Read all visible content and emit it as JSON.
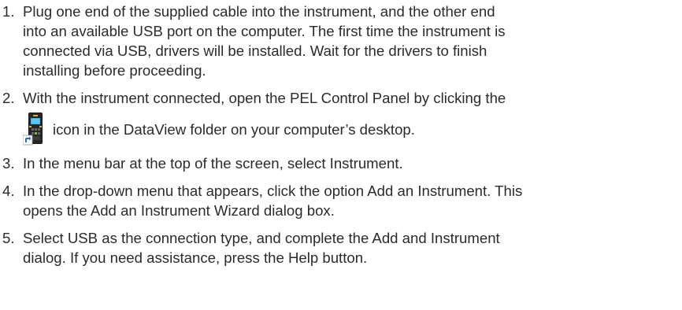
{
  "steps": [
    {
      "number": "1.",
      "lines": [
        "Plug one end of the supplied cable into the instrument, and the other end",
        "into an available USB port on the computer. The first time the instrument is",
        "connected via USB, drivers will be installed.  Wait for the drivers to finish",
        "installing before proceeding."
      ]
    },
    {
      "number": "2.",
      "line1": "With the instrument connected, open the PEL Control Panel by clicking the",
      "icon": "pel-control-panel-shortcut-icon",
      "line2": "icon in the DataView folder on your computer’s desktop."
    },
    {
      "number": "3.",
      "lines": [
        "In the menu bar at the top of the screen, select Instrument."
      ]
    },
    {
      "number": "4.",
      "lines": [
        "In the drop-down menu that appears, click the option Add an Instrument. This",
        "opens the Add an Instrument Wizard dialog box."
      ]
    },
    {
      "number": "5.",
      "lines": [
        "Select USB as the connection type, and complete the Add and Instrument",
        "dialog. If you need assistance, press the Help button."
      ]
    }
  ]
}
